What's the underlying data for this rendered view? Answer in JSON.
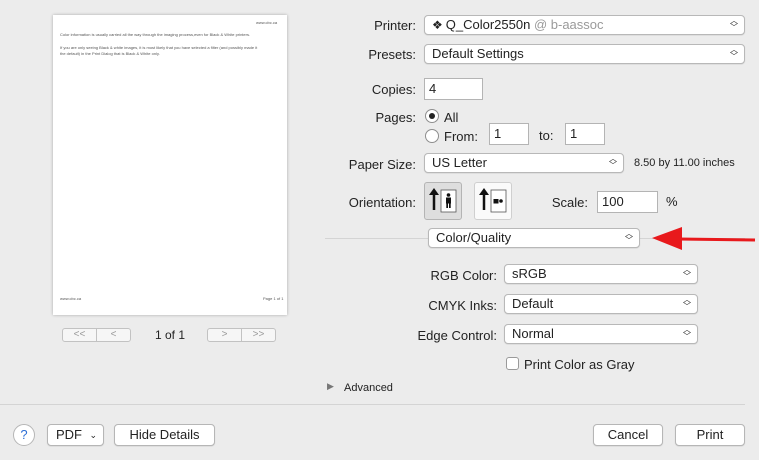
{
  "preview": {
    "header": "www.cbc.ca",
    "text1": "Color information is usually carried all the way through the imaging process,even for Black & White printers.",
    "text2a": "If you are only seeing Black & white images, it is most likely that you have selected a filter (and possibly made it",
    "text2b": "the default) in the Print Dialog that is Black & White only.",
    "footer_left": "www.cbc.ca",
    "footer_right": "Page 1 of 1",
    "page_counter": "1 of 1",
    "nav_first": "<<",
    "nav_prev": "<",
    "nav_next": ">",
    "nav_last": ">>"
  },
  "printer": {
    "label": "Printer:",
    "name": "Q_Color2550n",
    "location": "@ b-aassoc"
  },
  "presets": {
    "label": "Presets:",
    "value": "Default Settings"
  },
  "copies": {
    "label": "Copies:",
    "value": "4"
  },
  "pages": {
    "label": "Pages:",
    "all_label": "All",
    "from_label": "From:",
    "from_value": "1",
    "to_label": "to:",
    "to_value": "1",
    "selected": "all"
  },
  "paper_size": {
    "label": "Paper Size:",
    "value": "US Letter",
    "dimensions": "8.50 by 11.00 inches"
  },
  "orientation": {
    "label": "Orientation:",
    "selected": "portrait"
  },
  "scale": {
    "label": "Scale:",
    "value": "100",
    "unit": "%"
  },
  "panel_menu": {
    "value": "Color/Quality"
  },
  "annotation_arrow_color": "#e8191c",
  "rgb_color": {
    "label": "RGB Color:",
    "value": "sRGB"
  },
  "cmyk_inks": {
    "label": "CMYK Inks:",
    "value": "Default"
  },
  "edge_control": {
    "label": "Edge Control:",
    "value": "Normal"
  },
  "print_color_gray": {
    "label": "Print Color as Gray",
    "checked": false
  },
  "advanced": {
    "label": "Advanced"
  },
  "footer": {
    "help": "?",
    "pdf": "PDF",
    "hide_details": "Hide Details",
    "cancel": "Cancel",
    "print": "Print"
  }
}
